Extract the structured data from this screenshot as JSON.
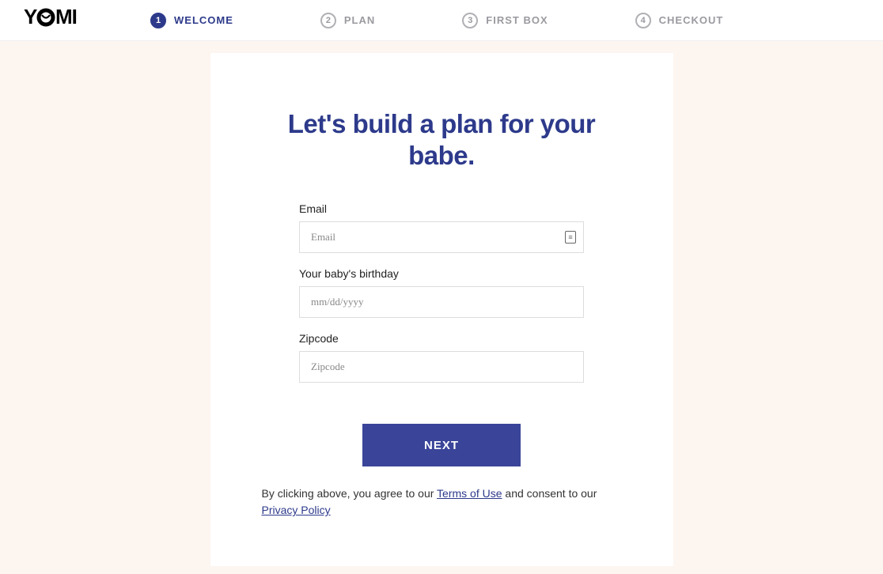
{
  "logo": "YOMI",
  "steps": [
    {
      "num": "1",
      "label": "WELCOME",
      "active": true
    },
    {
      "num": "2",
      "label": "PLAN",
      "active": false
    },
    {
      "num": "3",
      "label": "FIRST BOX",
      "active": false
    },
    {
      "num": "4",
      "label": "CHECKOUT",
      "active": false
    }
  ],
  "title": "Let's build a plan for your babe.",
  "form": {
    "email": {
      "label": "Email",
      "placeholder": "Email",
      "value": ""
    },
    "birthday": {
      "label": "Your baby's birthday",
      "placeholder": "mm/dd/yyyy",
      "value": ""
    },
    "zipcode": {
      "label": "Zipcode",
      "placeholder": "Zipcode",
      "value": ""
    }
  },
  "nextButton": "NEXT",
  "consent": {
    "prefix": "By clicking above, you agree to our ",
    "terms": "Terms of Use",
    "middle": " and consent to our ",
    "privacy": "Privacy Policy"
  }
}
